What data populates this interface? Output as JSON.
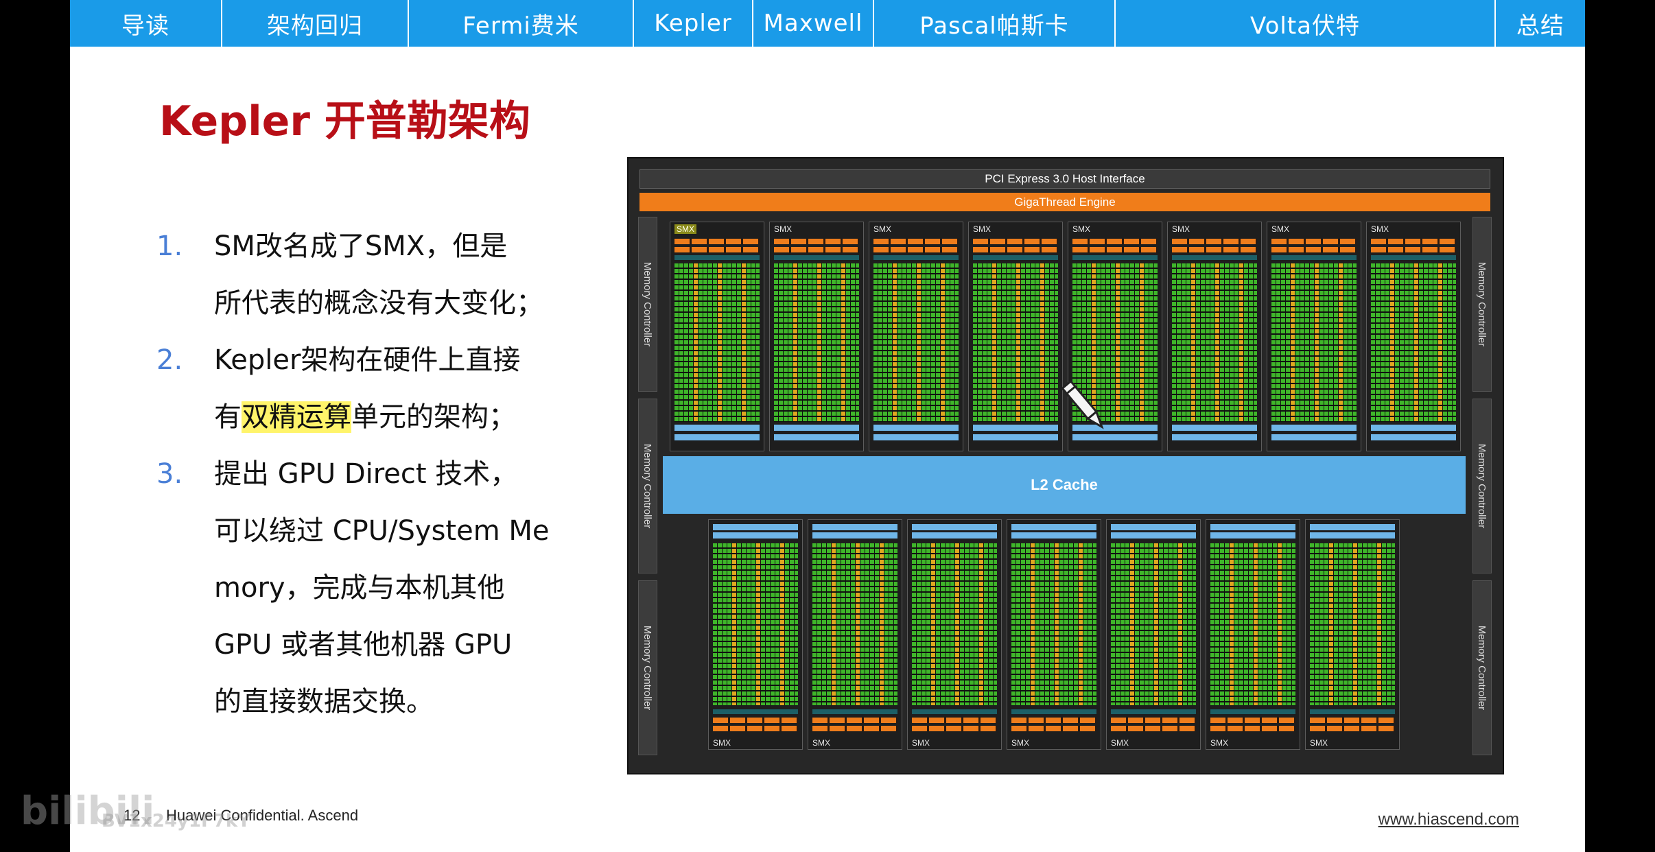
{
  "tabs": [
    {
      "label": "导读",
      "w": 222
    },
    {
      "label": "架构回归",
      "w": 272
    },
    {
      "label": "Fermi费米",
      "w": 328
    },
    {
      "label": "Kepler",
      "w": 174
    },
    {
      "label": "Maxwell",
      "w": 176
    },
    {
      "label": "Pascal帕斯卡",
      "w": 352
    },
    {
      "label": "Volta伏特",
      "w": 554
    },
    {
      "label": "总结",
      "w": 130
    }
  ],
  "slide": {
    "title": "Kepler 开普勒架构",
    "points": [
      {
        "num": "1.",
        "lines": [
          "SM改名成了SMX，但是",
          "所代表的概念没有大变化；"
        ]
      },
      {
        "num": "2.",
        "lines": [
          "Kepler架构在硬件上直接",
          "有双精运算单元的架构；"
        ]
      },
      {
        "num": "3.",
        "lines": [
          "提出 GPU Direct 技术，",
          "可以绕过 CPU/System Me",
          "mory，完成与本机其他",
          "GPU 或者其他机器 GPU",
          "的直接数据交换。"
        ]
      }
    ],
    "highlight": "双精运算"
  },
  "diagram": {
    "pcie": "PCI Express 3.0 Host Interface",
    "gigathread": "GigaThread Engine",
    "memory_controller": "Memory Controller",
    "l2": "L2 Cache",
    "smx_label": "SMX",
    "smx_count_top": 8,
    "smx_count_bottom": 7,
    "colors": {
      "core": "#3fb62a",
      "unit": "#e0a820",
      "orange": "#ef7d1c",
      "l2": "#5aaee6"
    }
  },
  "footer": {
    "page": "12",
    "text": "Huawei Confidential. Ascend",
    "url": "www.hiascend.com"
  },
  "watermark": {
    "logo": "bilibili",
    "id": "BV1x24y1F7kY"
  }
}
